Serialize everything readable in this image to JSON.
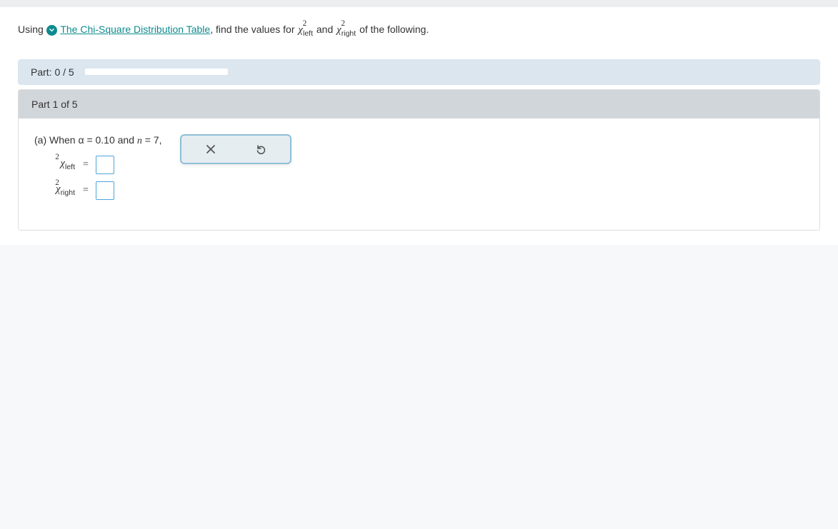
{
  "prompt": {
    "prefix": "Using ",
    "link_text": "The Chi-Square Distribution Table",
    "mid1": ", find the values for ",
    "chi_left_sub": "left",
    "and": " and ",
    "chi_right_sub": "right",
    "suffix": " of the following."
  },
  "progress": {
    "label": "Part: 0 / 5"
  },
  "panel": {
    "title": "Part 1 of 5",
    "question_a": "(a) When α = 0.10 and ",
    "n_eq": " = 7,",
    "left_sub": "left",
    "right_sub": "right",
    "eq": "="
  }
}
